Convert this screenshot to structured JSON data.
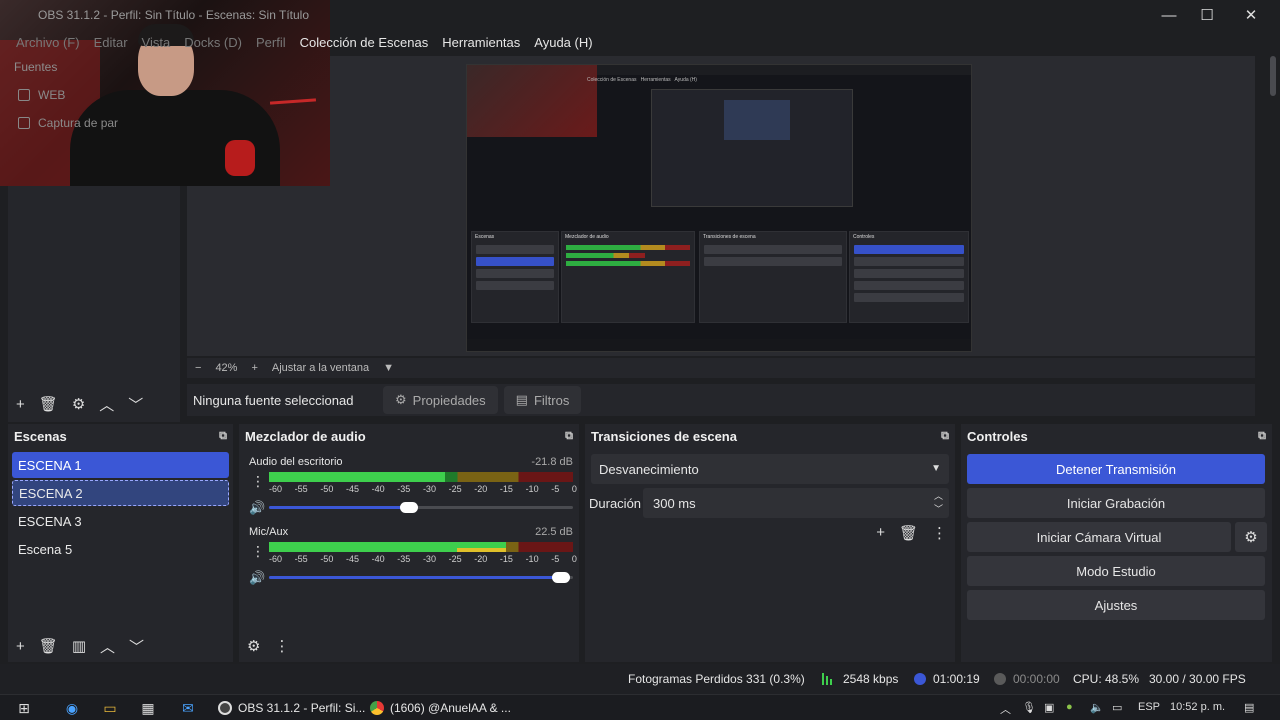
{
  "window": {
    "title": "OBS 31.1.2 - Perfil: Sin Título - Escenas: Sin Título"
  },
  "menu": [
    "Archivo (F)",
    "Editar",
    "Vista",
    "Docks (D)",
    "Perfil",
    "Colección de Escenas",
    "Herramientas",
    "Ayuda (H)"
  ],
  "sources_ghost": {
    "heading": "Fuentes",
    "items": [
      "WEB",
      "Captura de par"
    ]
  },
  "preview": {
    "zoom": "42%",
    "fit_label": "Ajustar a la ventana"
  },
  "context_bar": {
    "no_source": "Ninguna fuente seleccionad",
    "properties": "Propiedades",
    "filters": "Filtros"
  },
  "scenes": {
    "title": "Escenas",
    "items": [
      "ESCENA 1",
      "ESCENA 2",
      "ESCENA 3",
      "Escena 5"
    ]
  },
  "mixer": {
    "title": "Mezclador de audio",
    "channels": [
      {
        "name": "Audio del escritorio",
        "db": "-21.8 dB",
        "level": 0.58,
        "volume": 0.46
      },
      {
        "name": "Mic/Aux",
        "db": "22.5 dB",
        "level": 0.78,
        "volume": 0.96
      }
    ],
    "ticks": [
      "-60",
      "-55",
      "-50",
      "-45",
      "-40",
      "-35",
      "-30",
      "-25",
      "-20",
      "-15",
      "-10",
      "-5",
      "0"
    ]
  },
  "transitions": {
    "title": "Transiciones de escena",
    "selected": "Desvanecimiento",
    "duration_label": "Duración",
    "duration_value": "300 ms"
  },
  "controls": {
    "title": "Controles",
    "stop_stream": "Detener Transmisión",
    "start_record": "Iniciar Grabación",
    "start_virtual_cam": "Iniciar Cámara Virtual",
    "studio_mode": "Modo Estudio",
    "settings": "Ajustes"
  },
  "status": {
    "dropped_frames": "Fotogramas Perdidos 331 (0.3%)",
    "bitrate": "2548 kbps",
    "stream_time": "01:00:19",
    "record_time": "00:00:00",
    "cpu": "CPU: 48.5%",
    "fps": "30.00 / 30.00 FPS"
  },
  "taskbar": {
    "apps": [
      "OBS 31.1.2 - Perfil: Si...",
      "(1606) @AnuelAA & ..."
    ],
    "lang": "ESP",
    "clock": "10:52 p. m."
  },
  "colors": {
    "accent": "#3b57d6",
    "meter_green": "#3ecf4d",
    "meter_yellow": "#e0c02a",
    "meter_red": "#b82a2a"
  }
}
